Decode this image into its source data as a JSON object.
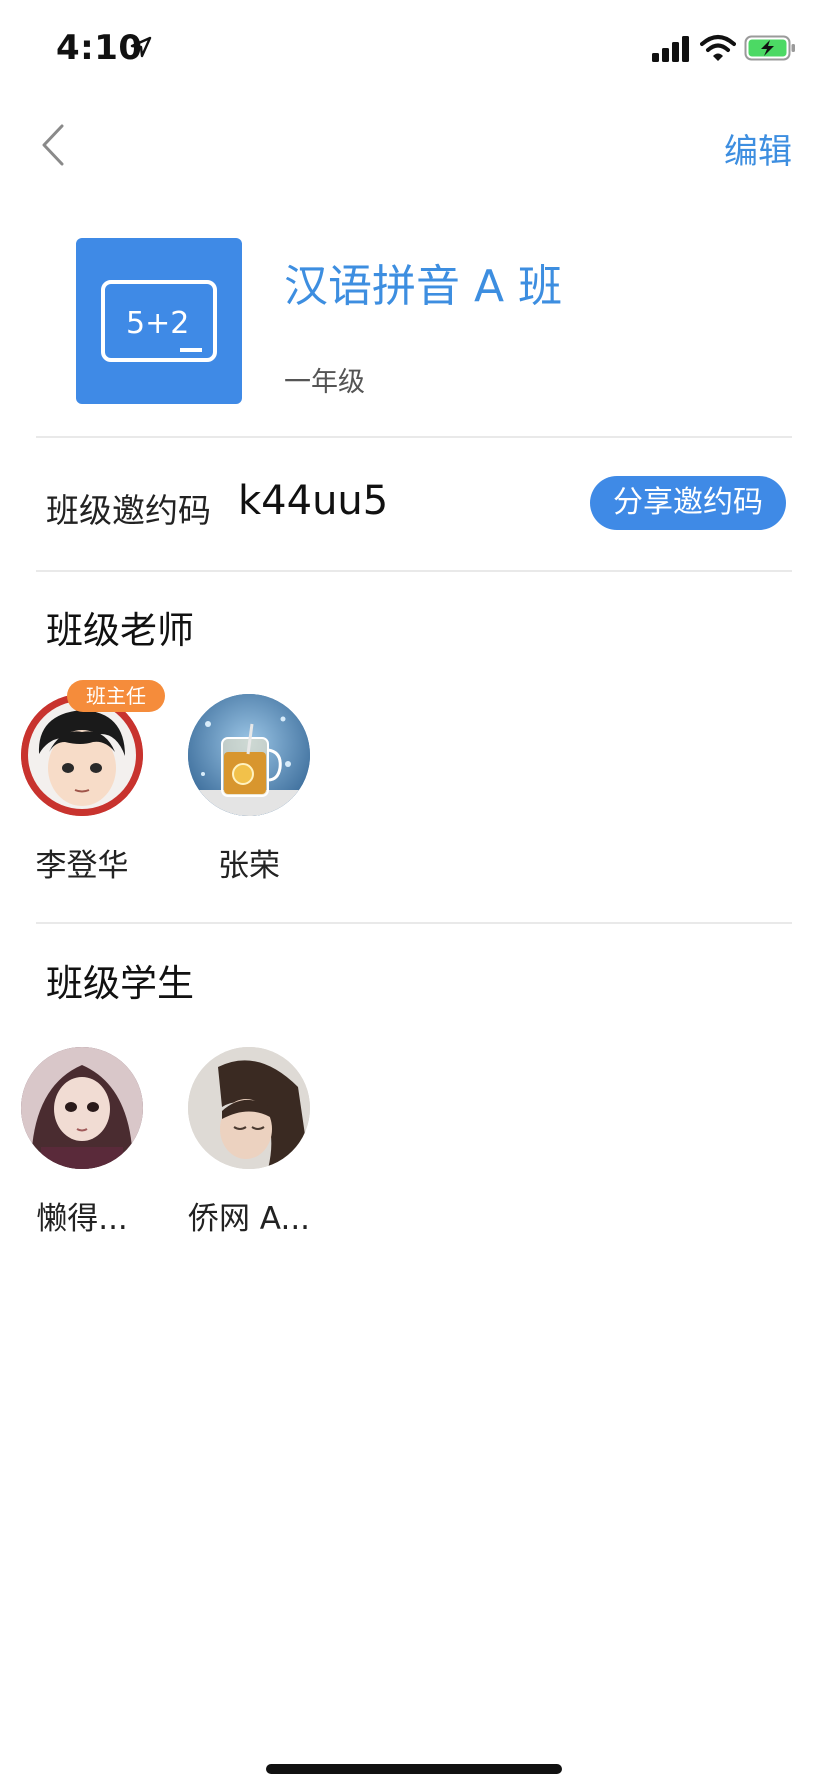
{
  "status_bar": {
    "time": "4:10"
  },
  "nav": {
    "edit_label": "编辑"
  },
  "class_info": {
    "title": "汉语拼音 A 班",
    "grade": "一年级",
    "icon_text": "5+2",
    "icon_color": "#3f8ae6"
  },
  "invite": {
    "label": "班级邀约码",
    "code": "k44uu5",
    "share_label": "分享邀约码"
  },
  "teachers": {
    "title": "班级老师",
    "members": [
      {
        "name": "李登华",
        "badge": "班主任"
      },
      {
        "name": "张荣"
      }
    ]
  },
  "students": {
    "title": "班级学生",
    "members": [
      {
        "name": "懒得..."
      },
      {
        "name": "侨网 A..."
      }
    ]
  },
  "colors": {
    "accent": "#3d8ee0",
    "badge": "#f58c3b"
  }
}
